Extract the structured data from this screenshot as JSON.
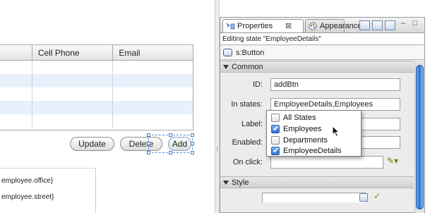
{
  "grid": {
    "columns": [
      "",
      "Cell Phone",
      "Email"
    ],
    "rows": [
      [
        "",
        "",
        ""
      ],
      [
        "",
        "",
        ""
      ],
      [
        "",
        "",
        ""
      ],
      [
        "",
        "",
        ""
      ],
      [
        "",
        "",
        ""
      ]
    ]
  },
  "buttons": {
    "update": "Update",
    "delete": "Delete",
    "add": "Add"
  },
  "form_lines": [
    "employee.office}",
    "employee.street}"
  ],
  "panel": {
    "tabs": [
      {
        "label": "Properties",
        "icon": "properties-icon",
        "active": true
      },
      {
        "label": "Appearance",
        "icon": "appearance-icon",
        "active": false
      }
    ],
    "close_glyph": "⊠",
    "toolbar_icons": [
      "category-view-icon",
      "list-view-icon",
      "alpha-view-icon"
    ],
    "window_controls": [
      "–",
      "□"
    ],
    "editing_state": "Editing state \"EmployeeDetails\"",
    "component": "s:Button",
    "sections": {
      "common": "Common",
      "style": "Style"
    },
    "properties": {
      "id": {
        "label": "ID:",
        "value": "addBtn"
      },
      "in_states": {
        "label": "In states:",
        "value": "EmployeeDetails,Employees"
      },
      "label": {
        "label": "Label:",
        "value": ""
      },
      "enabled": {
        "label": "Enabled:",
        "value": ""
      },
      "on_click": {
        "label": "On click:",
        "value": ""
      }
    }
  },
  "states_dropdown": [
    {
      "label": "All States",
      "checked": false
    },
    {
      "label": "Employees",
      "checked": true
    },
    {
      "label": "Departments",
      "checked": false
    },
    {
      "label": "EmployeeDetails",
      "checked": true
    }
  ],
  "colors": {
    "selection": "#5b8fd8",
    "row_alt": "#e8f0fb",
    "scroll_thumb": "#2d73d4"
  }
}
